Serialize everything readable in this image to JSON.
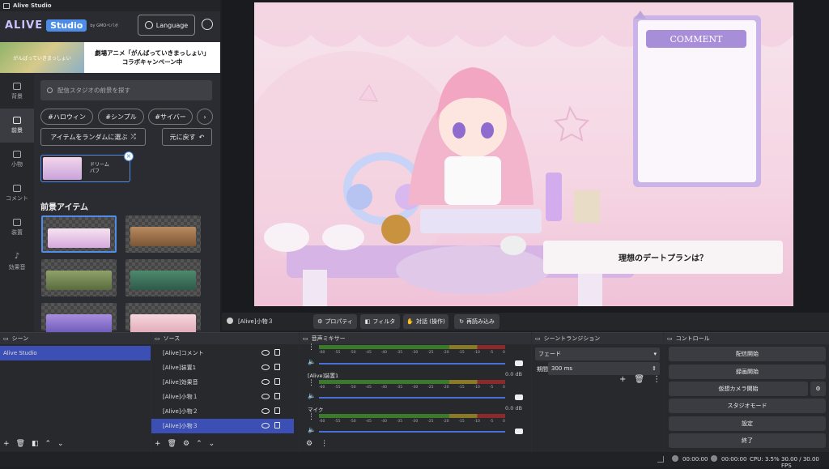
{
  "app": {
    "title": "Alive Studio"
  },
  "brand": {
    "logo": "ALIVE",
    "studio": "Studio",
    "by": "by GMOペパボ"
  },
  "header": {
    "language_label": "Language"
  },
  "banner": {
    "image_text": "がんばっていきまっしょい",
    "line1": "劇場アニメ「がんばっていきまっしょい」",
    "line2": "コラボキャンペーン中"
  },
  "sidenav": {
    "items": [
      {
        "label": "背景",
        "icon": "background-icon"
      },
      {
        "label": "前景",
        "icon": "foreground-icon"
      },
      {
        "label": "小物",
        "icon": "item-icon"
      },
      {
        "label": "コメント",
        "icon": "comment-icon"
      },
      {
        "label": "装置",
        "icon": "device-icon"
      },
      {
        "label": "効果音",
        "icon": "music-note-icon"
      }
    ]
  },
  "search": {
    "placeholder": "配信スタジオの前景を探す"
  },
  "chips": [
    "#ハロウィン",
    "#シンプル",
    "#サイバー"
  ],
  "actions": {
    "random_label": "アイテムをランダムに選ぶ",
    "undo_label": "元に戻す"
  },
  "selected_item": {
    "line1": "ドリーム",
    "line2": "パフ"
  },
  "foreground": {
    "title": "前景アイテム"
  },
  "scene": {
    "comment_title": "COMMENT",
    "question": "理想のデートプランは？"
  },
  "toolbar": {
    "source_name": "[Alive]小物３",
    "properties": "プロパティ",
    "filters": "フィルタ",
    "interact": "対話 (操作)",
    "reload": "再読み込み"
  },
  "docks": {
    "scenes": {
      "title": "シーン",
      "items": [
        "Alive Studio"
      ]
    },
    "sources": {
      "title": "ソース",
      "items": [
        "[Alive]コメント",
        "[Alive]装置1",
        "[Alive]効果音",
        "[Alive]小物１",
        "[Alive]小物２",
        "[Alive]小物３"
      ]
    },
    "mixer": {
      "title": "音声ミキサー",
      "channels": [
        {
          "name": "",
          "db": ""
        },
        {
          "name": "[Alive]装置1",
          "db": "0.0 dB"
        },
        {
          "name": "マイク",
          "db": "0.0 dB"
        }
      ],
      "scale": [
        "-60",
        "-55",
        "-50",
        "-45",
        "-40",
        "-35",
        "-30",
        "-25",
        "-20",
        "-15",
        "-10",
        "-5",
        "0"
      ]
    },
    "transitions": {
      "title": "シーントランジション",
      "type": "フェード",
      "duration_label": "期間",
      "duration": "300 ms"
    },
    "controls": {
      "title": "コントロール",
      "buttons": [
        "配信開始",
        "録画開始",
        "仮想カメラ開始",
        "スタジオモード",
        "設定",
        "終了"
      ]
    }
  },
  "status": {
    "stream_time": "00:00:00",
    "rec_time": "00:00:00",
    "cpu": "CPU: 3.5%",
    "fps": "30.00 / 30.00 FPS"
  }
}
